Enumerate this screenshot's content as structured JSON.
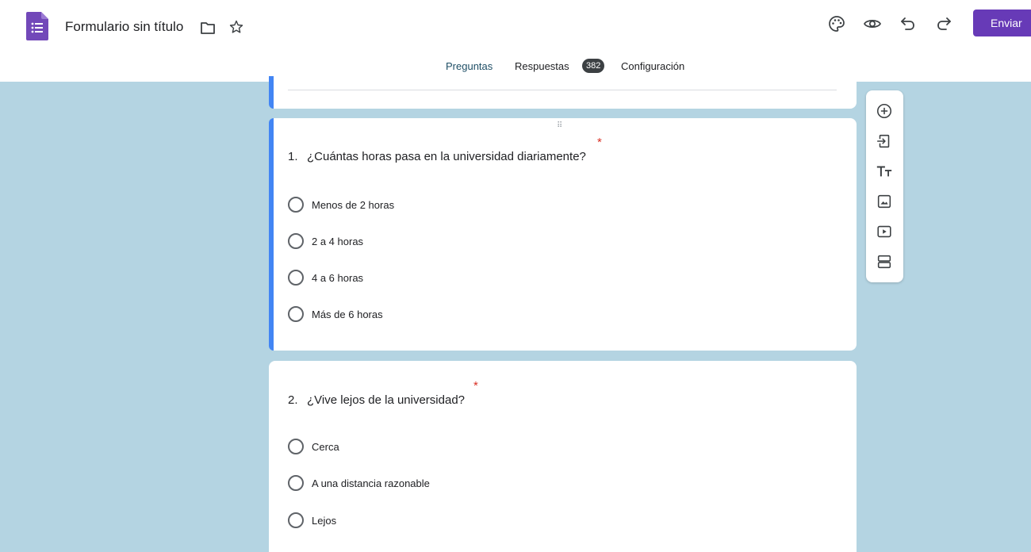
{
  "header": {
    "title": "Formulario sin título",
    "send_label": "Enviar"
  },
  "tabs": [
    {
      "label": "Preguntas",
      "active": true
    },
    {
      "label": "Respuestas",
      "badge": "382"
    },
    {
      "label": "Configuración"
    }
  ],
  "questions": [
    {
      "number": "1.",
      "text": "¿Cuántas horas pasa en la universidad diariamente?",
      "required_mark": "*",
      "options": [
        "Menos de 2 horas",
        "2 a 4 horas",
        "4 a 6 horas",
        "Más de 6 horas"
      ]
    },
    {
      "number": "2.",
      "text": "¿Vive lejos de la universidad?",
      "required_mark": "*",
      "options": [
        "Cerca",
        "A una distancia razonable",
        "Lejos"
      ]
    }
  ],
  "toolbar_icons": [
    "add-question-icon",
    "import-questions-icon",
    "add-title-icon",
    "add-image-icon",
    "add-video-icon",
    "add-section-icon"
  ],
  "colors": {
    "accent": "#673ab7",
    "focus": "#4285f4",
    "background": "#b4d4e2",
    "required": "#d93025"
  },
  "drag_glyph": "⠿"
}
